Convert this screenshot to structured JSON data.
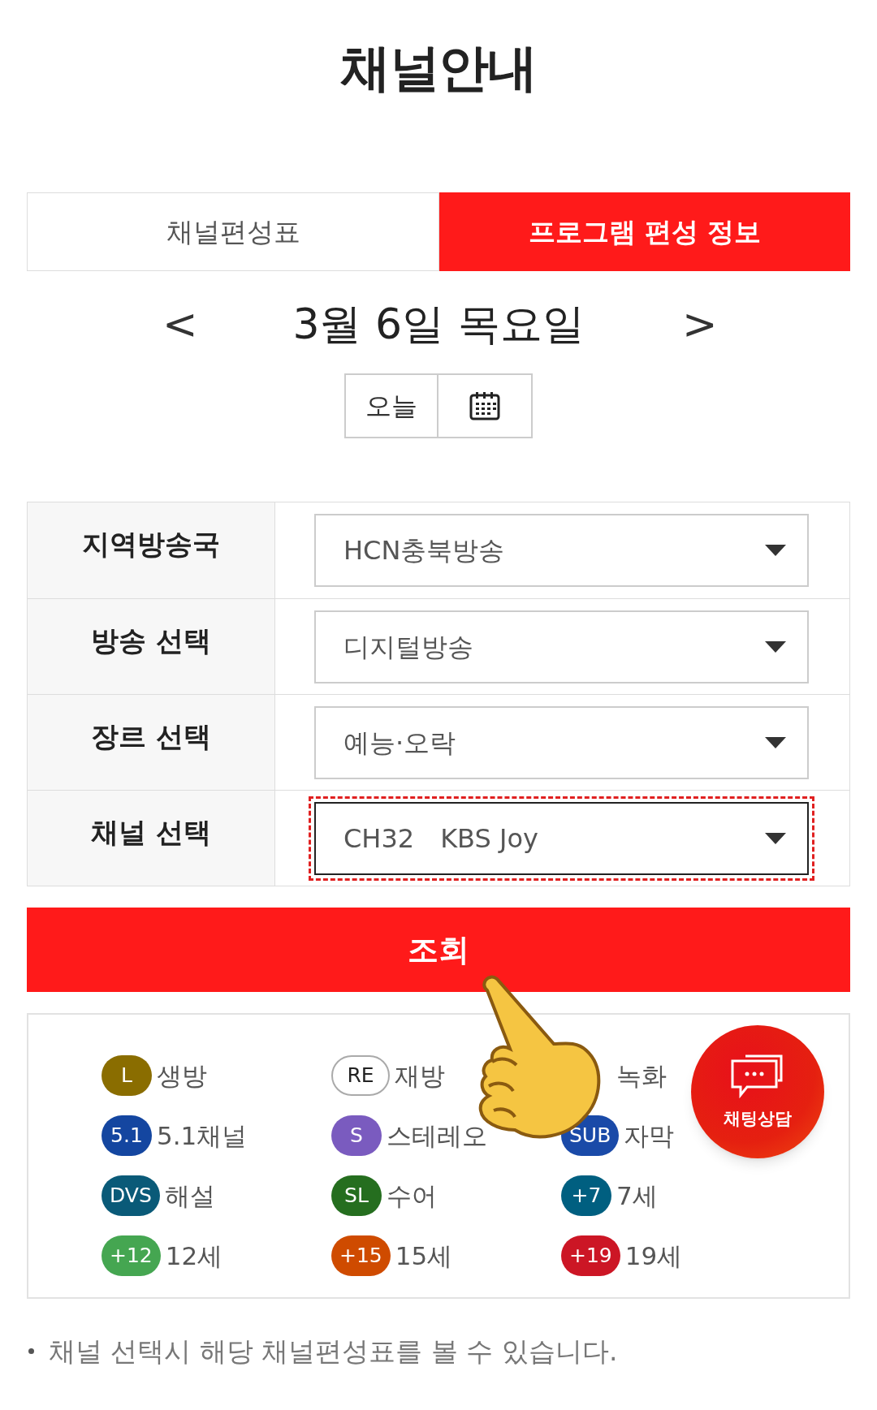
{
  "page_title": "채널안내",
  "tabs": [
    {
      "label": "채널편성표",
      "selected": false
    },
    {
      "label": "프로그램 편성 정보",
      "selected": true
    }
  ],
  "date": {
    "prev": "<",
    "label": "3월 6일 목요일",
    "next": ">"
  },
  "today_button": "오늘",
  "filters": [
    {
      "label": "지역방송국",
      "value": "HCN충북방송",
      "focused": false
    },
    {
      "label": "방송 선택",
      "value": "디지털방송",
      "focused": false
    },
    {
      "label": "장르 선택",
      "value": "예능·오락",
      "focused": false
    },
    {
      "label": "채널 선택",
      "value": "CH32　KBS Joy",
      "focused": true
    }
  ],
  "search_button": "조회",
  "legend": [
    {
      "kind": "filled",
      "badge": "L",
      "color": "#8a6d00",
      "label": "생방"
    },
    {
      "kind": "outline",
      "badge": "RE",
      "label": "재방"
    },
    {
      "kind": "hidden",
      "label": "녹화"
    },
    {
      "kind": "filled",
      "badge": "5.1",
      "color": "#1446a0",
      "label": "5.1채널"
    },
    {
      "kind": "filled",
      "badge": "S",
      "color": "#7a5bbf",
      "label": "스테레오"
    },
    {
      "kind": "filled",
      "badge": "SUB",
      "color": "#1a4aa8",
      "label": "자막"
    },
    {
      "kind": "filled",
      "badge": "DVS",
      "color": "#0a5a78",
      "label": "해설"
    },
    {
      "kind": "filled",
      "badge": "SL",
      "color": "#256e1f",
      "label": "수어"
    },
    {
      "kind": "filled",
      "badge": "+7",
      "color": "#005f80",
      "label": "7세"
    },
    {
      "kind": "filled",
      "badge": "+12",
      "color": "#45a651",
      "label": "12세"
    },
    {
      "kind": "filled",
      "badge": "+15",
      "color": "#cf4b00",
      "label": "15세"
    },
    {
      "kind": "filled",
      "badge": "+19",
      "color": "#cc1625",
      "label": "19세"
    }
  ],
  "chat_button": "채팅상담",
  "note": "채널 선택시 해당 채널편성표를 볼 수 있습니다."
}
